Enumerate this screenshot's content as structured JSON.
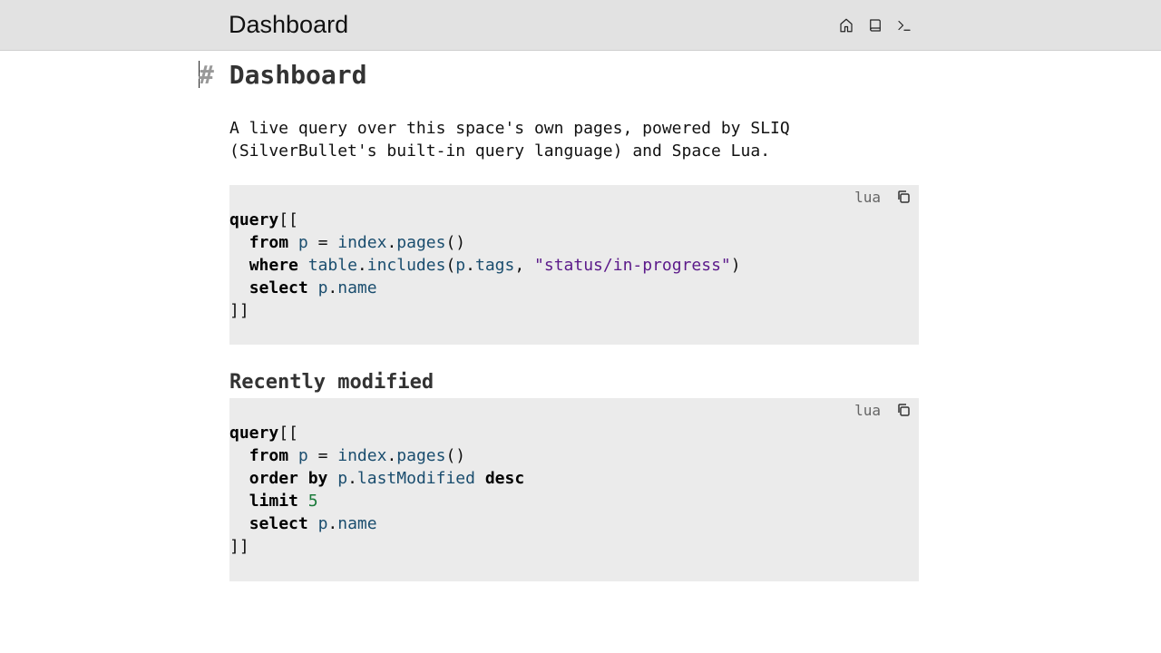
{
  "header": {
    "title": "Dashboard",
    "actions": [
      {
        "icon": "home-icon"
      },
      {
        "icon": "book-icon"
      },
      {
        "icon": "terminal-icon"
      }
    ]
  },
  "content": {
    "heading_marker": "#",
    "heading": "Dashboard",
    "paragraph_line1": "A live query over this space's own pages, powered by SLIQ",
    "paragraph_line2": "(SilverBullet's built-in query language) and Space Lua.",
    "block1": {
      "lang": "lua",
      "tokens": {
        "l1_kw": "query",
        "l1_rest": "[[",
        "l2_kw": "from",
        "l2_var": "p",
        "l2_eq": " = ",
        "l2_obj": "index",
        "l2_dot": ".",
        "l2_fn": "pages",
        "l2_paren": "()",
        "l3_kw": "where",
        "l3_obj": "table",
        "l3_dot": ".",
        "l3_fn": "includes",
        "l3_open": "(",
        "l3_p": "p",
        "l3_dot2": ".",
        "l3_field": "tags",
        "l3_comma": ", ",
        "l3_str": "\"status/in-progress\"",
        "l3_close": ")",
        "l4_kw": "select",
        "l4_p": "p",
        "l4_dot": ".",
        "l4_field": "name",
        "l5": "]]"
      }
    },
    "subheading": "Recently modified",
    "block2": {
      "lang": "lua",
      "tokens": {
        "l1_kw": "query",
        "l1_rest": "[[",
        "l2_kw": "from",
        "l2_var": "p",
        "l2_eq": " = ",
        "l2_obj": "index",
        "l2_dot": ".",
        "l2_fn": "pages",
        "l2_paren": "()",
        "l3_kw": "order by",
        "l3_p": "p",
        "l3_dot": ".",
        "l3_field": "lastModified",
        "l3_kw2": "desc",
        "l4_kw": "limit",
        "l4_num": "5",
        "l5_kw": "select",
        "l5_p": "p",
        "l5_dot": ".",
        "l5_field": "name",
        "l6": "]]"
      }
    }
  }
}
